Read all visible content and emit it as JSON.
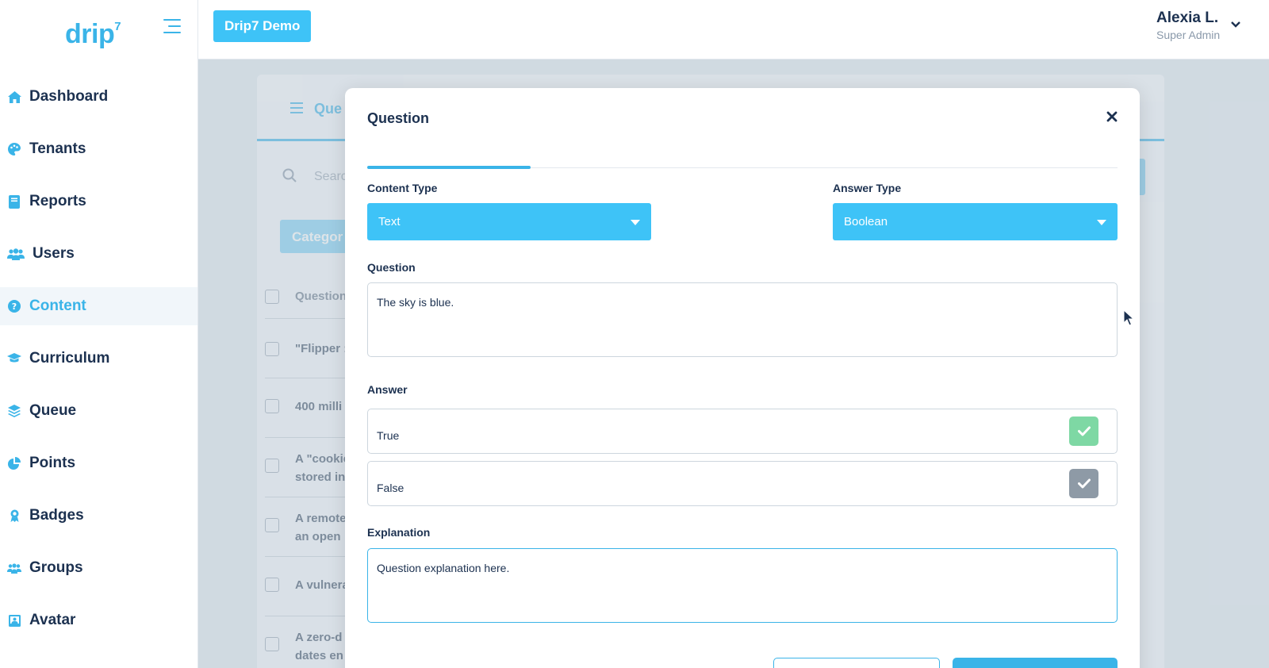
{
  "app": {
    "logo_text": "drip",
    "logo_sup": "7"
  },
  "header": {
    "tenant_button": "Drip7 Demo",
    "user_name": "Alexia L.",
    "user_role": "Super Admin"
  },
  "sidebar": {
    "items": [
      {
        "label": "Dashboard",
        "icon": "home-icon"
      },
      {
        "label": "Tenants",
        "icon": "palette-icon"
      },
      {
        "label": "Reports",
        "icon": "book-icon"
      },
      {
        "label": "Users",
        "icon": "users-icon"
      },
      {
        "label": "Content",
        "icon": "question-circle-icon",
        "active": true
      },
      {
        "label": "Curriculum",
        "icon": "graduation-cap-icon"
      },
      {
        "label": "Queue",
        "icon": "layers-icon"
      },
      {
        "label": "Points",
        "icon": "pie-chart-icon"
      },
      {
        "label": "Badges",
        "icon": "award-icon"
      },
      {
        "label": "Groups",
        "icon": "group-icon"
      },
      {
        "label": "Avatar",
        "icon": "portrait-icon"
      }
    ]
  },
  "background": {
    "tab_label": "Que",
    "search_placeholder": "Search",
    "category_button": "Categor",
    "rows": [
      {
        "line1": "Question"
      },
      {
        "line1": "\"Flipper :"
      },
      {
        "line1": "400 milli"
      },
      {
        "line1": "A \"cookie",
        "line2": "stored in"
      },
      {
        "line1": "A remote",
        "line2": "an open"
      },
      {
        "line1": "A vulnera"
      },
      {
        "line1": "A zero-d",
        "line2": "dates en"
      }
    ]
  },
  "modal": {
    "title": "Question",
    "close_glyph": "×",
    "content_type_label": "Content Type",
    "content_type_value": "Text",
    "answer_type_label": "Answer Type",
    "answer_type_value": "Boolean",
    "question_label": "Question",
    "question_value": "The sky is blue.",
    "answer_label": "Answer",
    "answers": [
      {
        "label": "True",
        "correct": true,
        "color": "#7ed8a4"
      },
      {
        "label": "False",
        "correct": false,
        "color": "#8e9aa6"
      }
    ],
    "explanation_label": "Explanation",
    "explanation_value": "Question explanation here."
  },
  "colors": {
    "accent": "#3ab4e8",
    "select_bg": "#3ec3f7",
    "text_dark": "#1c3150"
  }
}
